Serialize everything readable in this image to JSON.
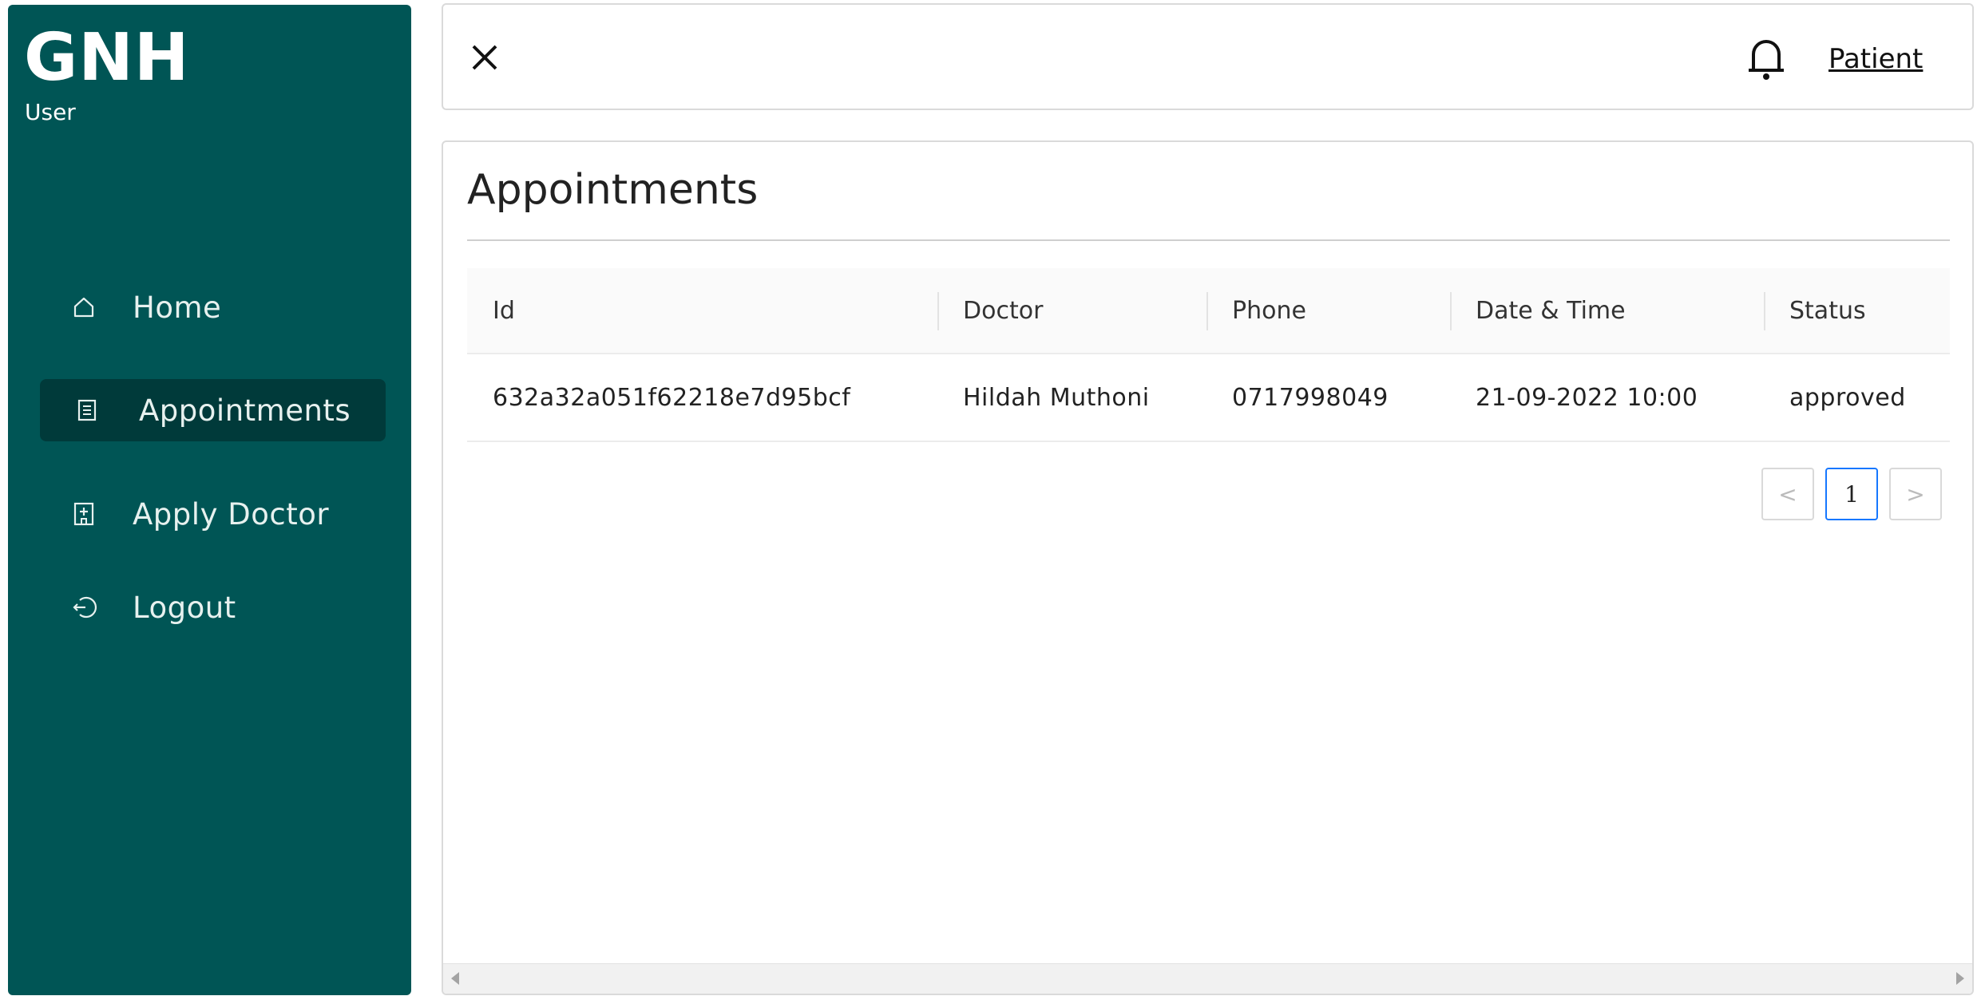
{
  "sidebar": {
    "logo": "GNH",
    "role": "User",
    "items": [
      {
        "label": "Home",
        "icon": "home-icon"
      },
      {
        "label": "Appointments",
        "icon": "list-icon",
        "active": true
      },
      {
        "label": "Apply Doctor",
        "icon": "hospital-icon"
      },
      {
        "label": "Logout",
        "icon": "logout-icon"
      }
    ]
  },
  "header": {
    "user_link": "Patient",
    "icons": [
      "close-icon",
      "bell-icon"
    ]
  },
  "main": {
    "title": "Appointments",
    "table": {
      "columns": [
        "Id",
        "Doctor",
        "Phone",
        "Date & Time",
        "Status"
      ],
      "rows": [
        [
          "632a32a051f62218e7d95bcf",
          "Hildah Muthoni",
          "0717998049",
          "21-09-2022 10:00",
          "approved"
        ]
      ]
    },
    "pagination": {
      "prev": "<",
      "current": "1",
      "next": ">"
    }
  },
  "colors": {
    "sidebar_bg": "#005555",
    "sidebar_active": "#003a3a",
    "pager_active_border": "#1677ff"
  }
}
